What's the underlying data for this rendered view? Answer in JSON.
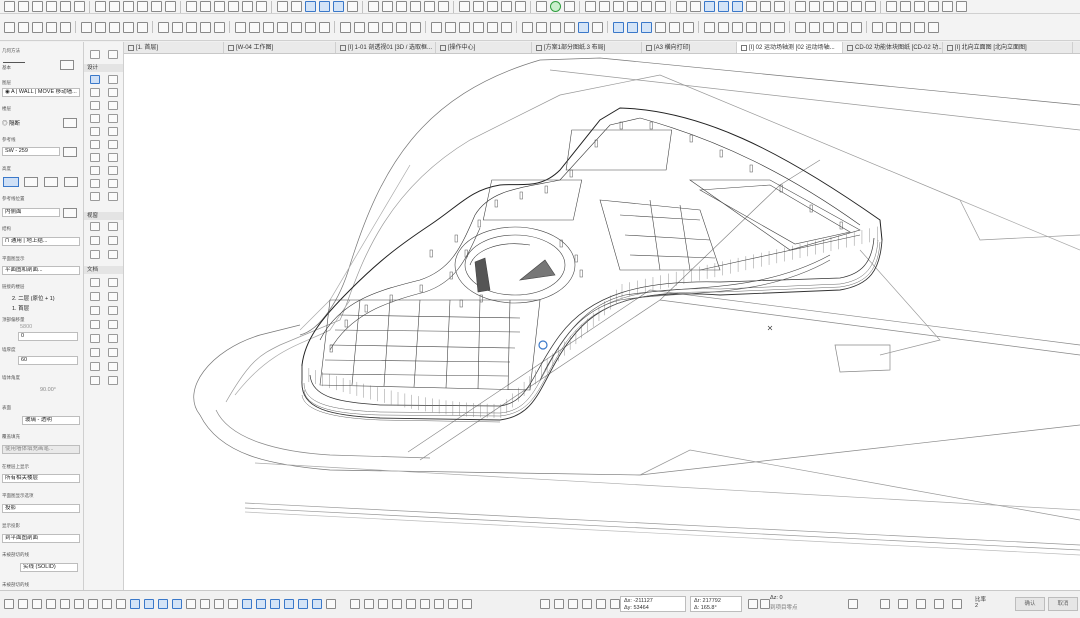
{
  "tabs": [
    {
      "label": "[1. 首层]",
      "active": false
    },
    {
      "label": "[W-04 工作图]",
      "active": false
    },
    {
      "label": "[I] 1-01 剖透视01 [3D / 选取框...",
      "active": false
    },
    {
      "label": "[操作中心]",
      "active": false
    },
    {
      "label": "[方案1部分图纸.3 布局]",
      "active": false
    },
    {
      "label": "[A3 横向打印]",
      "active": false
    },
    {
      "label": "[I] 02 运动场轴测 [02 运动场轴...",
      "active": true
    },
    {
      "label": "CD-02 功能体块图纸 [CD-02 功...",
      "active": false
    },
    {
      "label": "[I] 北向立面图 [北向立面图]",
      "active": false
    }
  ],
  "infobox": {
    "geo_label": "几何方法",
    "geo_value": "基本",
    "layer_label": "图层",
    "layer_value": "A | WALL | MOVE 移动墙...",
    "floor_label": "楼层",
    "floor_value": "隔断",
    "type_label": "参考线",
    "type_value": "SW - 259",
    "height_label": "高度",
    "material_label": "参考线位置",
    "material_value": "内侧面",
    "struct_label": "结构",
    "struct_value": "通用 | 地上结...",
    "view_label": "平面图显示",
    "view_value": "平面图和剖面...",
    "linked_label": "链接的楼层",
    "linked_top": "2. 二层 (原位 + 1)",
    "linked_bottom": "1. 首层",
    "offset_label": "顶部偏移量",
    "offset_top": "5800",
    "offset_bottom": "0",
    "thickness_label": "墙厚度",
    "thickness_value": "60",
    "angle_label": "墙体角度",
    "angle_value": "90.00°",
    "surface_label": "表面",
    "surface_value": "玻璃 - 透明",
    "override_label": "覆盖填充",
    "override_value": "使用墙体填充画笔...",
    "show_floor_label": "在楼层上显示",
    "show_floor_value": "所有相关楼层",
    "plan_label": "平面图显示选项",
    "plan_value": "投影",
    "cut_label": "显示投影",
    "cut_value": "到平面图剖面",
    "line_label": "未被剖切的线",
    "line_value": "实线 (SOLID)",
    "bottom_label": "未被剖切的线"
  },
  "toolbox": {
    "design": "设计",
    "viewpoint": "视窗",
    "document": "文档"
  },
  "status": {
    "x": "Δx: -211127",
    "y": "Δy: 53464",
    "r": "Δr: 217792",
    "a": "Δ: 165.8°",
    "z": "Δz: 0",
    "z_ref": "到项目零点",
    "scale": "比率",
    "scale_value": "2",
    "btn1": "确认",
    "btn2": "取消"
  },
  "colors": {
    "accent": "#3a78c9",
    "green": "#2e9d3e"
  }
}
